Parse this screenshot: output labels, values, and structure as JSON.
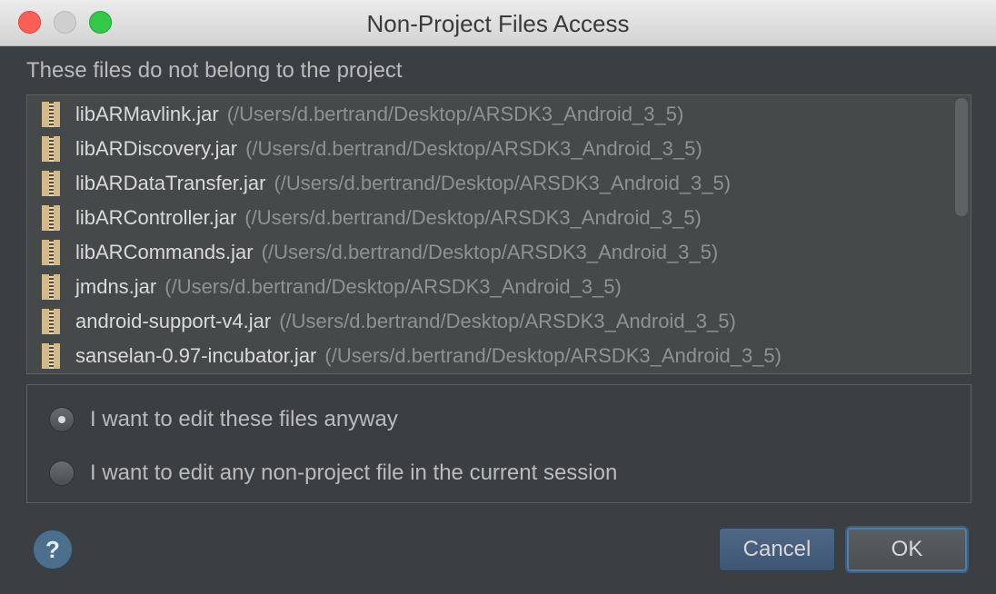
{
  "window": {
    "title": "Non-Project Files Access"
  },
  "heading": "These files do not belong to the project",
  "files": [
    {
      "name": "libARMavlink.jar",
      "path": "(/Users/d.bertrand/Desktop/ARSDK3_Android_3_5)"
    },
    {
      "name": "libARDiscovery.jar",
      "path": "(/Users/d.bertrand/Desktop/ARSDK3_Android_3_5)"
    },
    {
      "name": "libARDataTransfer.jar",
      "path": "(/Users/d.bertrand/Desktop/ARSDK3_Android_3_5)"
    },
    {
      "name": "libARController.jar",
      "path": "(/Users/d.bertrand/Desktop/ARSDK3_Android_3_5)"
    },
    {
      "name": "libARCommands.jar",
      "path": "(/Users/d.bertrand/Desktop/ARSDK3_Android_3_5)"
    },
    {
      "name": "jmdns.jar",
      "path": "(/Users/d.bertrand/Desktop/ARSDK3_Android_3_5)"
    },
    {
      "name": "android-support-v4.jar",
      "path": "(/Users/d.bertrand/Desktop/ARSDK3_Android_3_5)"
    },
    {
      "name": "sanselan-0.97-incubator.jar",
      "path": "(/Users/d.bertrand/Desktop/ARSDK3_Android_3_5)"
    }
  ],
  "options": [
    {
      "label": "I want to edit these files anyway",
      "selected": true
    },
    {
      "label": "I want to edit any non-project file in the current session",
      "selected": false
    }
  ],
  "buttons": {
    "help": "?",
    "cancel": "Cancel",
    "ok": "OK"
  },
  "icons": {
    "jar": "jar-file-icon",
    "help": "help-icon"
  }
}
